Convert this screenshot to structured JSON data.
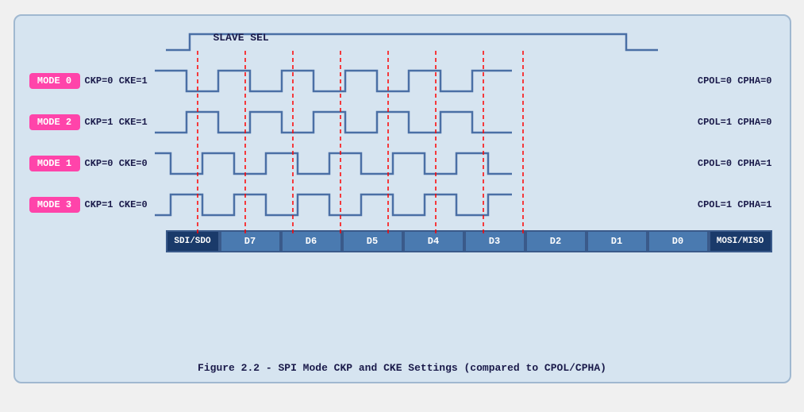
{
  "title": "Figure 2.2 - SPI Mode CKP and CKE Settings (compared to CPOL/CPHA)",
  "slave_sel_label": "SLAVE SEL",
  "modes": [
    {
      "label": "MODE 0",
      "ckp": "CKP=0 CKE=1",
      "cpol": "CPOL=0 CPHA=0",
      "wave_type": "high_first"
    },
    {
      "label": "MODE 2",
      "ckp": "CKP=1 CKE=1",
      "cpol": "CPOL=1 CPHA=0",
      "wave_type": "low_first"
    },
    {
      "label": "MODE 1",
      "ckp": "CKP=0 CKE=0",
      "cpol": "CPOL=0 CPHA=1",
      "wave_type": "high_first_offset"
    },
    {
      "label": "MODE 3",
      "ckp": "CKP=1 CKE=0",
      "cpol": "CPOL=1 CPHA=1",
      "wave_type": "low_first_offset"
    }
  ],
  "data_cells": [
    "SDI/SDO",
    "D7",
    "D6",
    "D5",
    "D4",
    "D3",
    "D2",
    "D1",
    "D0",
    "MOSI/MISO"
  ],
  "caption": "Figure 2.2 - SPI Mode CKP and CKE Settings (compared to CPOL/CPHA)"
}
